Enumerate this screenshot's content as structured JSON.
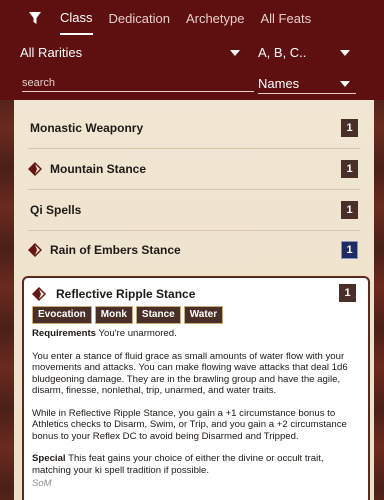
{
  "header": {
    "tabs": [
      "Class",
      "Dedication",
      "Archetype",
      "All Feats"
    ],
    "active_tab": "Class",
    "rarity_select": "All Rarities",
    "sort_select": "A, B, C..",
    "search_placeholder": "search",
    "search_value": "",
    "field_select": "Names"
  },
  "feats": [
    {
      "name": "Monastic Weaponry",
      "level": "1",
      "has_action": false
    },
    {
      "name": "Mountain Stance",
      "level": "1",
      "has_action": true
    },
    {
      "name": "Qi Spells",
      "level": "1",
      "has_action": false
    },
    {
      "name": "Rain of Embers Stance",
      "level": "1",
      "has_action": true,
      "highlight": true
    }
  ],
  "expanded": {
    "name": "Reflective Ripple Stance",
    "level": "1",
    "traits": [
      "Evocation",
      "Monk",
      "Stance",
      "Water"
    ],
    "requirements_label": "Requirements",
    "requirements_text": "You're unarmored.",
    "paragraph1": "You enter a stance of fluid grace as small amounts of water flow with your movements and attacks. You can make flowing wave attacks that deal 1d6 bludgeoning damage. They are in the brawling group and have the agile, disarm, finesse, nonlethal, trip, unarmed, and water traits.",
    "paragraph2": "While in Reflective Ripple Stance, you gain a +1 circumstance bonus to Athletics checks to Disarm, Swim, or Trip, and you gain a +2 circumstance bonus to your Reflex DC to avoid being Disarmed and Tripped.",
    "special_label": "Special",
    "special_text": "This feat gains your choice of either the divine or occult trait, matching your ki spell tradition if possible.",
    "source": "SoM"
  },
  "colors": {
    "header_bg": "#5e0f10",
    "panel_bg": "#f1e6d3",
    "badge_bg": "#4a2f28",
    "highlight_badge_bg": "#1e2a62"
  }
}
